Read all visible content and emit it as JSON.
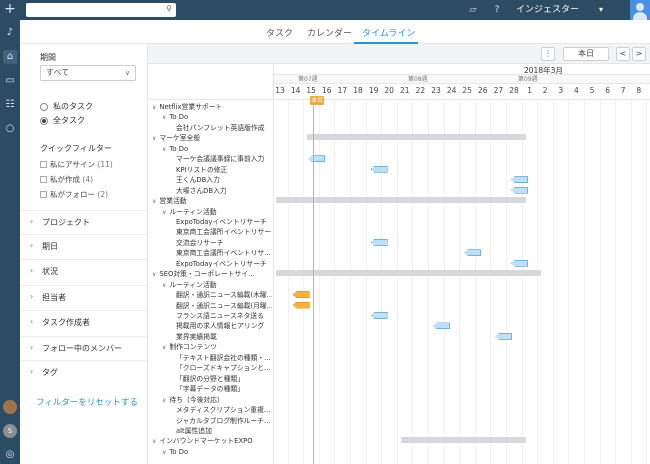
{
  "topbar": {
    "search_placeholder": "",
    "user_name": "インジェスター"
  },
  "rail": {
    "avatar_letter": "S"
  },
  "view_tabs": [
    "タスク",
    "カレンダー",
    "タイムライン"
  ],
  "active_tab": "タイムライン",
  "filters": {
    "period_label": "期間",
    "period_value": "すべて",
    "my_tasks": "私のタスク",
    "all_tasks": "全タスク",
    "selected_scope": "全タスク",
    "quick_filter_label": "クイックフィルター",
    "quick_items": [
      {
        "label": "私にアサイン",
        "count": "(11)"
      },
      {
        "label": "私が作成",
        "count": "(4)"
      },
      {
        "label": "私がフォロー",
        "count": "(2)"
      }
    ],
    "sections": [
      "プロジェクト",
      "期日",
      "状況",
      "担当者",
      "タスク作成者",
      "フォロー中のメンバー",
      "タグ"
    ],
    "reset_label": "フィルターをリセットする"
  },
  "toolbar": {
    "today_button": "本日",
    "prev": "<",
    "next": ">"
  },
  "timeline": {
    "month_label": "2018年3月",
    "week_labels": [
      "第07週",
      "第08週",
      "第09週"
    ],
    "days": [
      "13",
      "14",
      "15",
      "16",
      "17",
      "18",
      "19",
      "20",
      "21",
      "22",
      "23",
      "24",
      "25",
      "26",
      "27",
      "28",
      "1",
      "2",
      "3",
      "4",
      "5",
      "6",
      "7",
      "8"
    ],
    "today_label": "本日",
    "today_day": "15"
  },
  "tree": [
    {
      "text": "Netflix営業サポート",
      "level": 0,
      "toggle": true
    },
    {
      "text": "To Do",
      "level": 1,
      "toggle": true
    },
    {
      "text": "会社パンフレット英語版作成",
      "level": 2
    },
    {
      "text": "マーケ室全般",
      "level": 0,
      "toggle": true
    },
    {
      "text": "To Do",
      "level": 1,
      "toggle": true
    },
    {
      "text": "マーケ会議議事録に事前入力",
      "level": 2
    },
    {
      "text": "KPIリストの修正",
      "level": 2
    },
    {
      "text": "王くんDB入力",
      "level": 2
    },
    {
      "text": "大塚さんDB入力",
      "level": 2
    },
    {
      "text": "営業活動",
      "level": 0,
      "toggle": true
    },
    {
      "text": "ルーティン活動",
      "level": 1,
      "toggle": true
    },
    {
      "text": "ExpoTodayイベントリサーチ",
      "level": 2
    },
    {
      "text": "東京商工会議所イベントリサーチ",
      "level": 2
    },
    {
      "text": "交流会リサーチ",
      "level": 2
    },
    {
      "text": "東京商工会議所イベントリサ...",
      "level": 2
    },
    {
      "text": "ExpoTodayイベントリサーチ",
      "level": 2
    },
    {
      "text": "SEO対策・コーポレートサイ...",
      "level": 0,
      "toggle": true
    },
    {
      "text": "ルーティン活動",
      "level": 1,
      "toggle": true
    },
    {
      "text": "翻訳・通訳ニュース編載(木曜...",
      "level": 2
    },
    {
      "text": "翻訳・通訳ニュース編載(月曜...",
      "level": 2
    },
    {
      "text": "フランス語ニュースネタ送る",
      "level": 2
    },
    {
      "text": "掲載用の求人情報ヒアリング",
      "level": 2
    },
    {
      "text": "業界実績掲載",
      "level": 2
    },
    {
      "text": "制作コンテンツ",
      "level": 1,
      "toggle": true
    },
    {
      "text": "「テキスト翻訳会社の種類・...",
      "level": 2
    },
    {
      "text": "「クローズドキャプションと...",
      "level": 2
    },
    {
      "text": "「翻訳の分野と種類」",
      "level": 2
    },
    {
      "text": "「字幕データの種類」",
      "level": 2
    },
    {
      "text": "待ち（今後対応）",
      "level": 1,
      "toggle": true
    },
    {
      "text": "メタディスクリプション重複...",
      "level": 2
    },
    {
      "text": "ジャカルタブログ制作ルーチ...",
      "level": 2
    },
    {
      "text": "alt属性追加",
      "level": 2
    },
    {
      "text": "インバウンドマーケットEXPO",
      "level": 0,
      "toggle": true
    },
    {
      "text": "To Do",
      "level": 1,
      "toggle": true
    }
  ],
  "group_bars": [
    {
      "row": 3,
      "start_day": "15",
      "end_day": "28"
    },
    {
      "row": 9,
      "start_day": "13",
      "end_day": "28"
    },
    {
      "row": 16,
      "start_day": "13",
      "end_day": "1"
    },
    {
      "row": 32,
      "start_day": "21",
      "end_day": "28"
    }
  ],
  "task_markers": [
    {
      "row": 5,
      "day": "15",
      "color": "blue"
    },
    {
      "row": 6,
      "day": "19",
      "color": "blue"
    },
    {
      "row": 7,
      "day": "28",
      "color": "blue"
    },
    {
      "row": 8,
      "day": "28",
      "color": "blue"
    },
    {
      "row": 13,
      "day": "19",
      "color": "blue"
    },
    {
      "row": 14,
      "day": "25",
      "color": "blue"
    },
    {
      "row": 15,
      "day": "28",
      "color": "blue"
    },
    {
      "row": 18,
      "day": "14",
      "color": "orange"
    },
    {
      "row": 19,
      "day": "14",
      "color": "orange"
    },
    {
      "row": 20,
      "day": "19",
      "color": "blue"
    },
    {
      "row": 21,
      "day": "23",
      "color": "blue"
    },
    {
      "row": 22,
      "day": "27",
      "color": "blue"
    }
  ]
}
